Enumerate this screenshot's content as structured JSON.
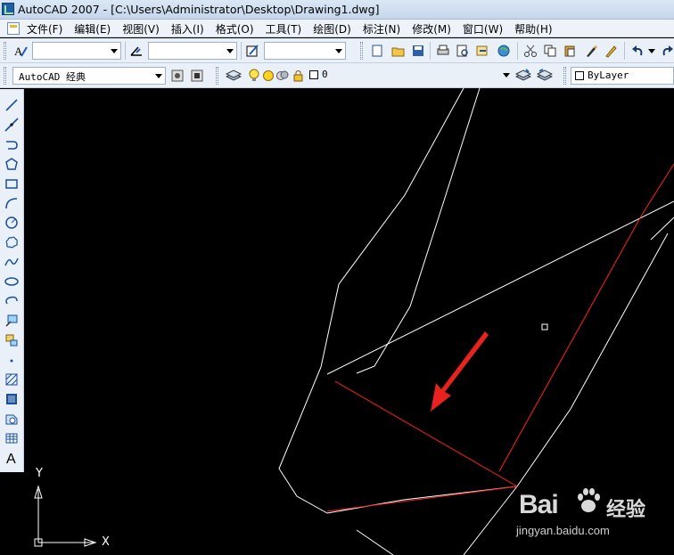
{
  "window": {
    "title": "AutoCAD 2007 - [C:\\Users\\Administrator\\Desktop\\Drawing1.dwg]"
  },
  "menu": {
    "items": [
      {
        "label": "文件(F)"
      },
      {
        "label": "编辑(E)"
      },
      {
        "label": "视图(V)"
      },
      {
        "label": "插入(I)"
      },
      {
        "label": "格式(O)"
      },
      {
        "label": "工具(T)"
      },
      {
        "label": "绘图(D)"
      },
      {
        "label": "标注(N)"
      },
      {
        "label": "修改(M)"
      },
      {
        "label": "窗口(W)"
      },
      {
        "label": "帮助(H)"
      }
    ]
  },
  "toolbar2": {
    "workspace": "AutoCAD 经典",
    "layer_name": "0",
    "color": "ByLayer"
  },
  "ucs": {
    "x_label": "X",
    "y_label": "Y"
  },
  "watermark": {
    "brand": "Bai",
    "jingyan": "经验",
    "url": "jingyan.baidu.com"
  },
  "colors": {
    "canvas_bg": "#000000",
    "line_white": "#ffffff",
    "line_red": "#ff2020",
    "arrow_red": "#e8231f"
  }
}
